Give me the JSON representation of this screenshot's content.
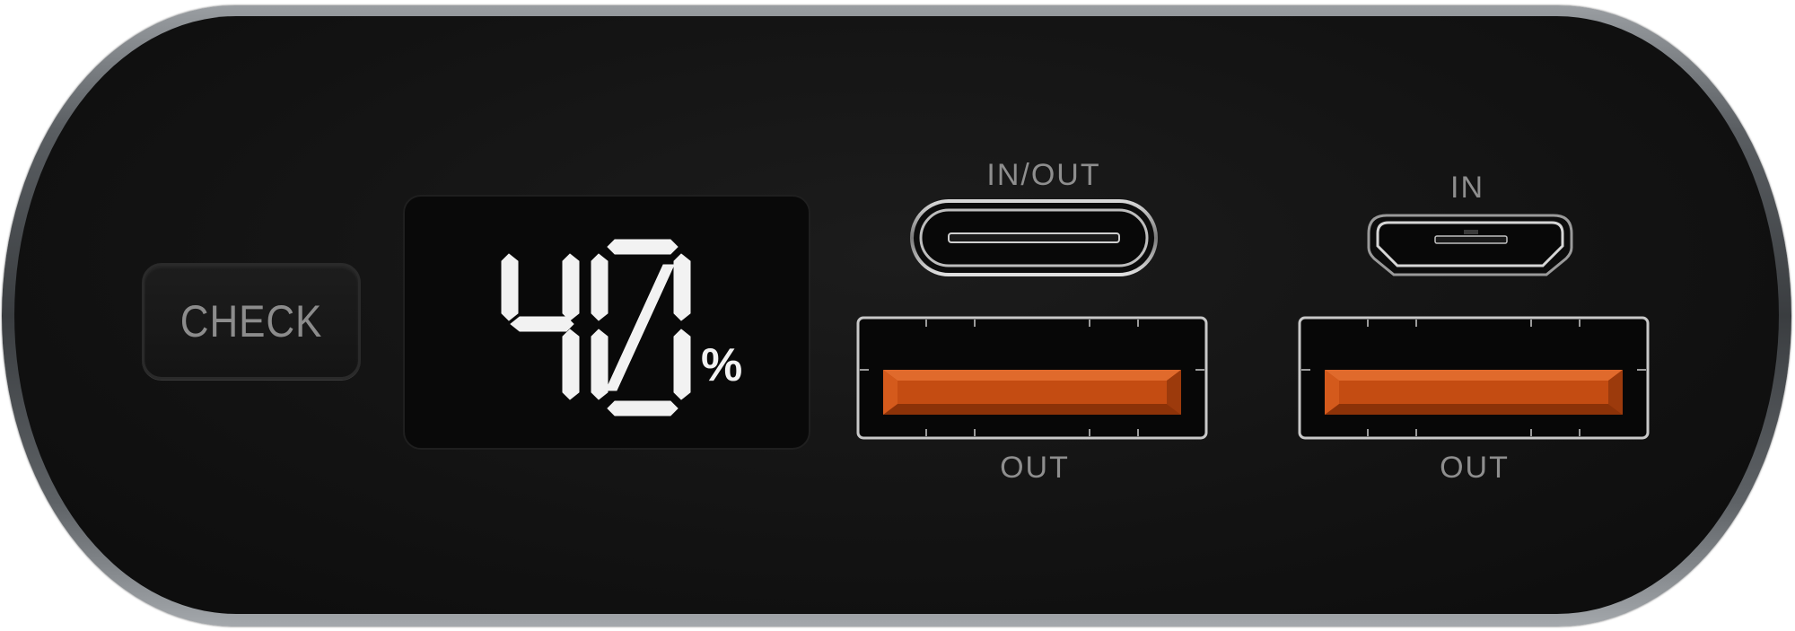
{
  "device": {
    "check_button_label": "CHECK",
    "battery_level": "40",
    "battery_unit": "%",
    "battery_fraction": 0.4
  },
  "ports": {
    "usb_c_label": "IN/OUT",
    "micro_usb_label": "IN",
    "usb_a_left_label": "OUT",
    "usb_a_right_label": "OUT"
  },
  "colors": {
    "body": "#121212",
    "rim": "#7a7e82",
    "segment": "#f2f2f2",
    "usb_a_insert": "#c94a12",
    "label": "#8e8e8e"
  }
}
